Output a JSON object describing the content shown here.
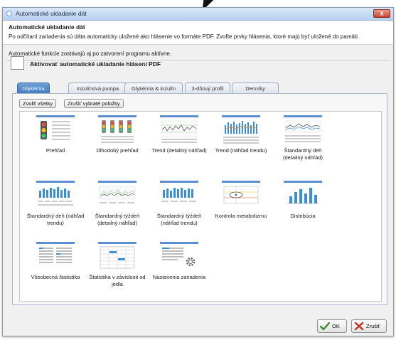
{
  "window": {
    "title": "Automatické ukladanie dát",
    "close_label": "X"
  },
  "header": {
    "heading": "Automatické ukladanie dát",
    "description": "Po odčítaní zariadenia sú dáta automaticky uložené ako hlásenie vo formáte PDF. Zvoľte prvky hlásenia, ktoré majú byť uložené do pamäti."
  },
  "note": "Automatické funkcie zostávajú aj po zatvorení programu aktívne.",
  "activate": {
    "label": "Aktivovať automatické ukladanie hlásení PDF",
    "checked": false
  },
  "tabs": [
    {
      "label": "Glykémia",
      "active": true
    },
    {
      "label": "Inzulínová pumpa",
      "active": false
    },
    {
      "label": "Glykémia & inzulín",
      "active": false
    },
    {
      "label": "3-dňový profil",
      "active": false
    },
    {
      "label": "Denníky",
      "active": false
    }
  ],
  "panel": {
    "select_all_label": "Zvoliť všetky",
    "deselect_label": "Zrušiť vybraté položky"
  },
  "reports": [
    {
      "label": "Prehľad",
      "icon": "overview-traffic-light-icon"
    },
    {
      "label": "Dlhodobý prehľad",
      "icon": "long-term-traffic-light-icon"
    },
    {
      "label": "Trend (detailný náhľad)",
      "icon": "trend-detail-chart-icon"
    },
    {
      "label": "Trend (náhľad trendu)",
      "icon": "trend-bars-chart-icon"
    },
    {
      "label": "Štandardný deň (detailný náhľad)",
      "icon": "standard-day-detail-chart-icon"
    },
    {
      "label": "Štandardný deň (náhľad trendu)",
      "icon": "standard-day-trend-chart-icon"
    },
    {
      "label": "Štandardný týždeň (detailný náhľad)",
      "icon": "standard-week-detail-chart-icon"
    },
    {
      "label": "Štandardný týždeň (náhľad trendu)",
      "icon": "standard-week-trend-chart-icon"
    },
    {
      "label": "Kontrola metabolizmu",
      "icon": "metabolism-control-chart-icon"
    },
    {
      "label": "Distribúcia",
      "icon": "distribution-chart-icon"
    },
    {
      "label": "Všeobecná štatistika",
      "icon": "general-statistics-table-icon"
    },
    {
      "label": "Štatistika v závislosti od jedla",
      "icon": "meal-statistics-table-icon"
    },
    {
      "label": "Nastavenia zariadenia",
      "icon": "device-settings-gear-icon"
    }
  ],
  "footer": {
    "ok_label": "OK",
    "cancel_label": "Zrušiť"
  },
  "colors": {
    "accent": "#3f78bf",
    "header_bar": "#5b8fcf",
    "trend_blue": "#3b8fd4",
    "cancel_red": "#c8321e",
    "ok_green": "#3f8a2e"
  }
}
